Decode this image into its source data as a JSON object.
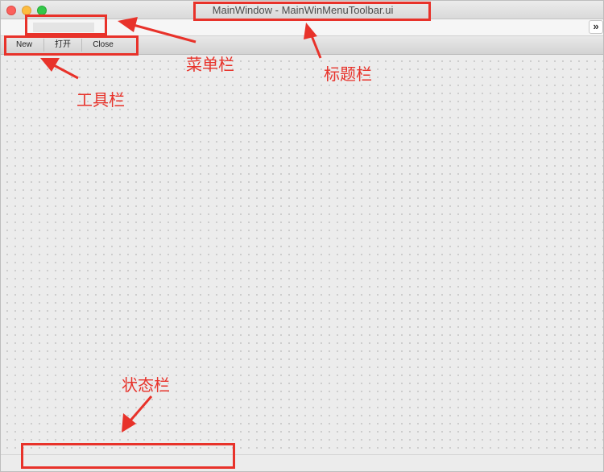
{
  "window": {
    "title": "MainWindow - MainWinMenuToolbar.ui",
    "controls": [
      "close",
      "minimize",
      "zoom"
    ]
  },
  "menubar": {
    "extension_icon": "chevron-double-right-icon",
    "extension_glyph": "»"
  },
  "toolbar": {
    "items": [
      {
        "label": "New"
      },
      {
        "label": "打开"
      },
      {
        "label": "Close"
      }
    ]
  },
  "annotations": {
    "menubar_label": "菜单栏",
    "titlebar_label": "标题栏",
    "toolbar_label": "工具栏",
    "statusbar_label": "状态栏",
    "color": "#e8322a"
  }
}
